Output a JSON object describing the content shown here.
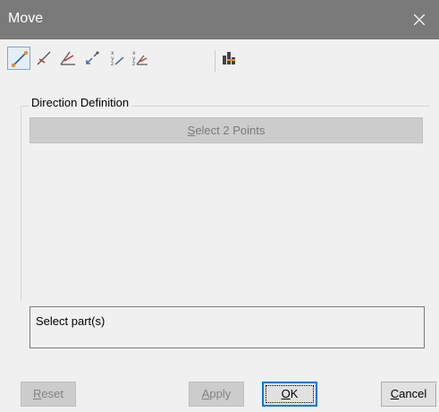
{
  "window": {
    "title": "Move",
    "close_glyph": "✕"
  },
  "toolbar": {
    "buttons": [
      {
        "icon": "two-points-direction-icon",
        "active": true
      },
      {
        "icon": "line-direction-icon",
        "active": false
      },
      {
        "icon": "line-angle-direction-icon",
        "active": false
      },
      {
        "icon": "vector-direction-icon",
        "active": false
      },
      {
        "icon": "axis-direction-icon",
        "active": false
      },
      {
        "icon": "axis-plane-direction-icon",
        "active": false
      },
      {
        "icon": "measure-icon",
        "active": false
      }
    ]
  },
  "direction_group": {
    "legend": "Direction Definition",
    "select_button": {
      "mnemonic": "S",
      "rest": "elect 2 Points",
      "enabled": false
    }
  },
  "status": {
    "text": "Select part(s)"
  },
  "footer": {
    "reset": {
      "mnemonic": "R",
      "rest": "eset",
      "enabled": false
    },
    "apply": {
      "mnemonic": "A",
      "rest": "pply",
      "enabled": false
    },
    "ok": {
      "mnemonic": "O",
      "rest": "K",
      "enabled": true
    },
    "cancel": {
      "mnemonic": "C",
      "rest": "ancel",
      "enabled": true
    }
  },
  "colors": {
    "titlebar": "#7a7a7a",
    "dialog_background": "#f0f0f0",
    "focus_border": "#0078d7",
    "icon_orange": "#e8912d",
    "icon_blue": "#2f5fa5"
  }
}
